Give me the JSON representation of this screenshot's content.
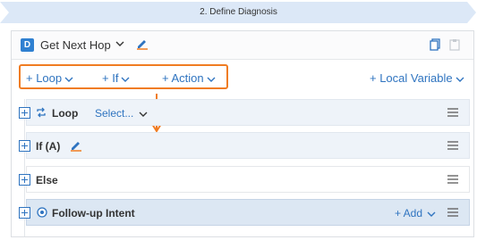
{
  "step": {
    "title": "2. Define Diagnosis"
  },
  "header": {
    "badge": "D",
    "name": "Get Next Hop"
  },
  "toolbar": {
    "loop_label": "+ Loop",
    "if_label": "+ If",
    "action_label": "+ Action",
    "local_variable_label": "+ Local Variable"
  },
  "blocks": {
    "loop": {
      "label": "Loop",
      "select_label": "Select..."
    },
    "if": {
      "label": "If (A)"
    },
    "else": {
      "label": "Else"
    },
    "followup": {
      "label": "Follow-up Intent",
      "add_label": "+ Add"
    }
  },
  "colors": {
    "accent": "#2f74c0",
    "highlight": "#f07c22",
    "banner": "#dce8f7"
  }
}
